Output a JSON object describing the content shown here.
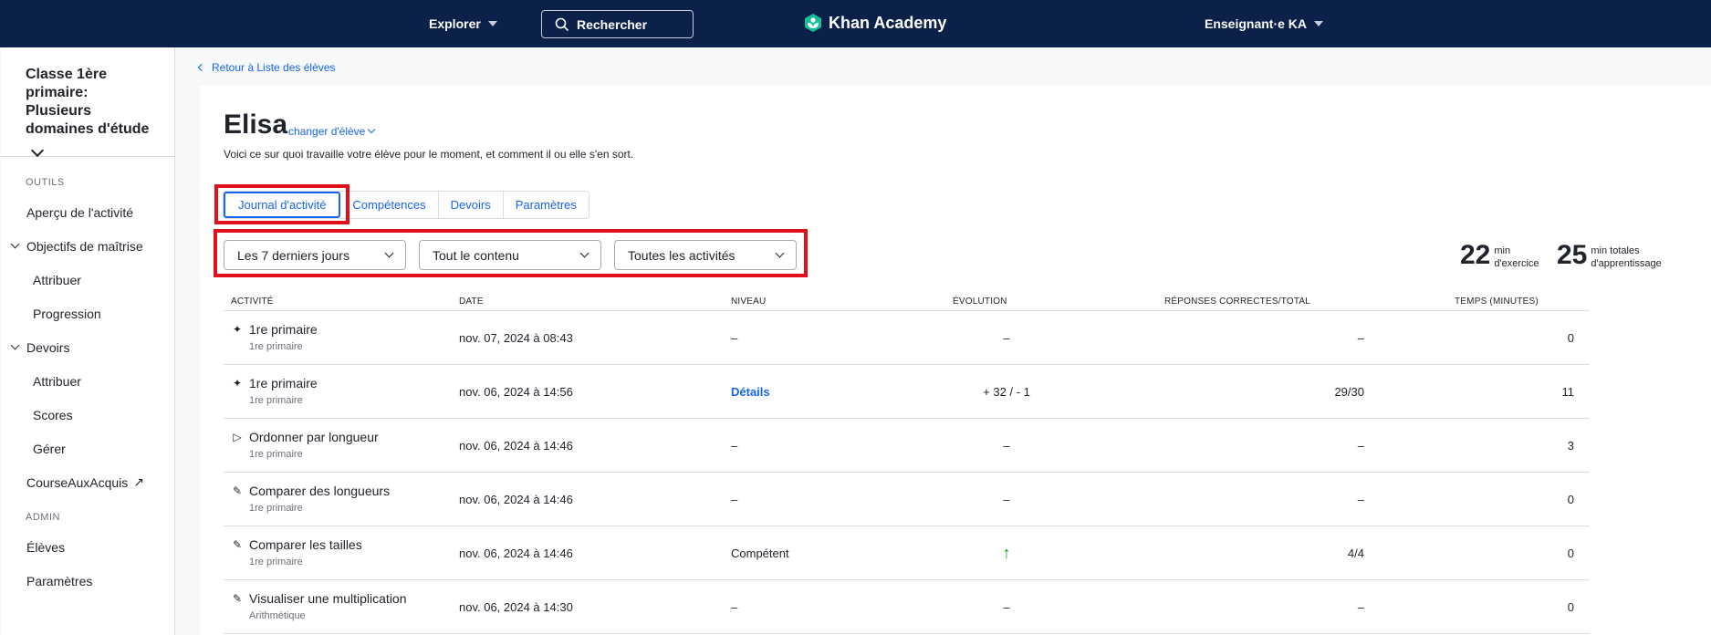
{
  "topbar": {
    "explore": "Explorer",
    "search": "Rechercher",
    "logo": "Khan Academy",
    "user": "Enseignant·e KA"
  },
  "sidebar": {
    "class_title": "Classe 1ère primaire: Plusieurs domaines d'étude",
    "tools_heading": "OUTILS",
    "activity_overview": "Aperçu de l'activité",
    "mastery_goals": "Objectifs de maîtrise",
    "mastery_assign": "Attribuer",
    "mastery_progress": "Progression",
    "assignments": "Devoirs",
    "assignments_assign": "Attribuer",
    "assignments_scores": "Scores",
    "assignments_manage": "Gérer",
    "course_challenge": "CourseAuxAcquis",
    "admin_heading": "ADMIN",
    "students": "Élèves",
    "settings": "Paramètres"
  },
  "main": {
    "breadcrumb": "Retour à Liste des élèves",
    "student_name": "Elisa",
    "change_student": "changer d'élève",
    "subtitle": "Voici ce sur quoi travaille votre élève pour le moment, et comment il ou elle s'en sort.",
    "tabs": [
      "Journal d'activité",
      "Compétences",
      "Devoirs",
      "Paramètres"
    ],
    "filters": [
      "Les 7 derniers jours",
      "Tout le contenu",
      "Toutes les activités"
    ],
    "stats": [
      {
        "value": "22",
        "label1": "min",
        "label2": "d'exercice"
      },
      {
        "value": "25",
        "label1": "min totales",
        "label2": "d'apprentissage"
      }
    ],
    "columns": [
      "ACTIVITÉ",
      "DATE",
      "NIVEAU",
      "ÉVOLUTION",
      "RÉPONSES CORRECTES/TOTAL",
      "TEMPS (MINUTES)"
    ],
    "rows": [
      {
        "icon": "✦",
        "title": "1re primaire",
        "sub": "1re primaire",
        "date": "nov. 07, 2024 à 08:43",
        "level": "–",
        "evo": "–",
        "ans": "–",
        "time": "0"
      },
      {
        "icon": "✦",
        "title": "1re primaire",
        "sub": "1re primaire",
        "date": "nov. 06, 2024 à 14:56",
        "level": "Détails",
        "evo": "+ 32 / - 1",
        "ans": "29/30",
        "time": "11"
      },
      {
        "icon": "▷",
        "title": "Ordonner par longueur",
        "sub": "1re primaire",
        "date": "nov. 06, 2024 à 14:46",
        "level": "–",
        "evo": "–",
        "ans": "–",
        "time": "3"
      },
      {
        "icon": "✎",
        "title": "Comparer des longueurs",
        "sub": "1re primaire",
        "date": "nov. 06, 2024 à 14:46",
        "level": "–",
        "evo": "–",
        "ans": "–",
        "time": "0"
      },
      {
        "icon": "✎",
        "title": "Comparer les tailles",
        "sub": "1re primaire",
        "date": "nov. 06, 2024 à 14:46",
        "level": "Compétent",
        "evo": "↑",
        "ans": "4/4",
        "time": "0"
      },
      {
        "icon": "✎",
        "title": "Visualiser une multiplication",
        "sub": "Arithmétique",
        "date": "nov. 06, 2024 à 14:30",
        "level": "–",
        "evo": "–",
        "ans": "–",
        "time": "0"
      }
    ]
  },
  "colors": {
    "navy": "#0b2149",
    "link_blue": "#1865f2",
    "highlight_red": "#e0101b",
    "success_green": "#00a60e"
  }
}
